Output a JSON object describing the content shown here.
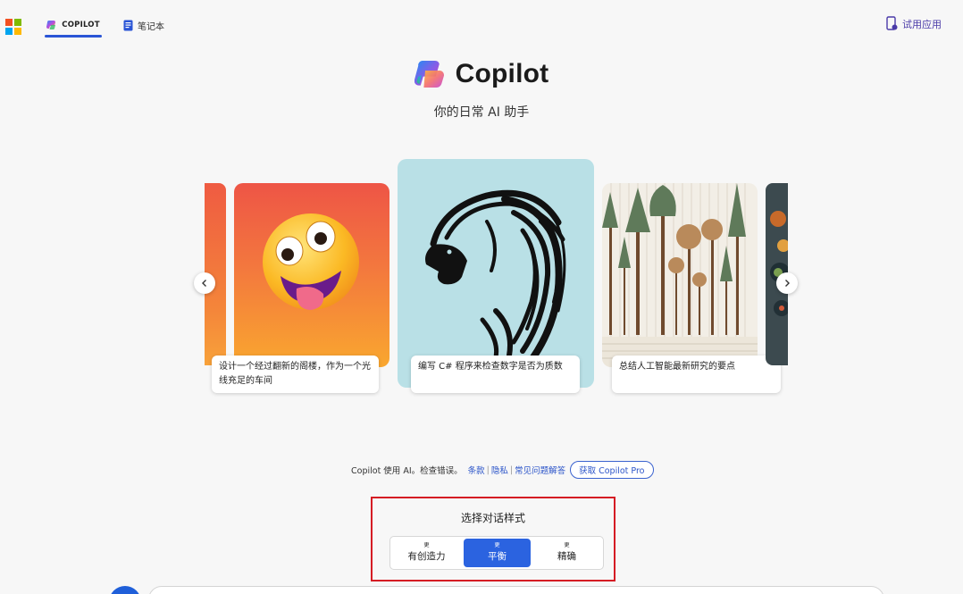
{
  "header": {
    "tabs": [
      {
        "label": "COPILOT",
        "active": true
      },
      {
        "label": "笔记本",
        "active": false
      }
    ],
    "try_app_label": "试用应用",
    "accent": "#2a55d6"
  },
  "hero": {
    "app_name": "Copilot",
    "tagline": "你的日常 AI 助手"
  },
  "carousel": {
    "cards": [
      {
        "image": "zany-emoji-face",
        "caption": "设计一个经过翻新的阁楼，作为一个光线充足的车间"
      },
      {
        "image": "lion-line-art",
        "caption": "编写 C# 程序来检查数字是否为质数"
      },
      {
        "image": "tree-species-chart",
        "caption": "总结人工智能最新研究的要点"
      }
    ],
    "prev_icon": "chevron-left-icon",
    "next_icon": "chevron-right-icon"
  },
  "footer": {
    "disclaimer": "Copilot 使用 AI。检查错误。",
    "links": [
      "条款",
      "隐私",
      "常见问题解答"
    ],
    "pro_button": "获取 Copilot Pro"
  },
  "conversation_style": {
    "title": "选择对话样式",
    "options": [
      {
        "more": "更",
        "label": "有创造力",
        "active": false
      },
      {
        "more": "更",
        "label": "平衡",
        "active": true
      },
      {
        "more": "更",
        "label": "精确",
        "active": false
      }
    ],
    "active_color": "#2b63e0",
    "highlight_color": "#d51c24"
  }
}
